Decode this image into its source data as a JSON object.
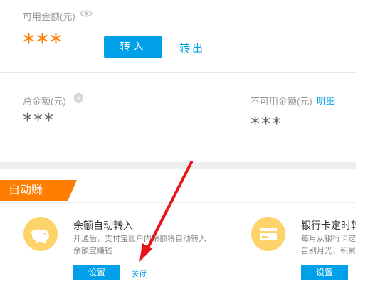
{
  "balance": {
    "available_label": "可用金额(元)",
    "available_value": "***",
    "transfer_in": "转入",
    "transfer_out": "转出"
  },
  "summary": {
    "total_label": "总金额(元)",
    "total_value": "***",
    "unavailable_label": "不可用金额(元)",
    "detail_link": "明细",
    "unavailable_value": "***"
  },
  "auto_earn": {
    "tag": "自动赚",
    "cards": [
      {
        "icon": "piggy-bank-icon",
        "title": "余额自动转入",
        "desc_line1": "开通后，支付宝账户内余额将自动转入",
        "desc_line2": "余额宝赚钱",
        "setup": "设置",
        "close": "关闭"
      },
      {
        "icon": "bank-card-icon",
        "title": "银行卡定时转",
        "desc_line1": "每月从银行卡定",
        "desc_line2": "告别月光、积累",
        "setup": "设置"
      }
    ]
  },
  "colors": {
    "accent_blue": "#00a0e9",
    "accent_orange": "#ff7d00",
    "icon_yellow": "#fdd36a",
    "annotation_red": "#e8141b"
  },
  "annotation": "red-arrow-pointing-to-close"
}
